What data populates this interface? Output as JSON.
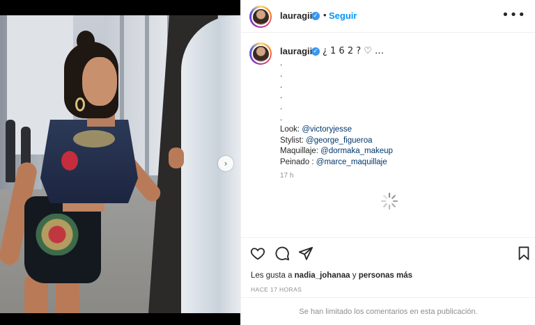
{
  "post": {
    "username": "lauragii",
    "follow_label": "Seguir",
    "header_dot": "•",
    "more_label": "•••",
    "caption_first": "¿ 1 6 2 ? ♡ …",
    "caption_lines": [
      {
        "text": ".",
        "mention": ""
      },
      {
        "text": ".",
        "mention": ""
      },
      {
        "text": ".",
        "mention": ""
      },
      {
        "text": ".",
        "mention": ""
      },
      {
        "text": ".",
        "mention": ""
      },
      {
        "text": ".",
        "mention": ""
      },
      {
        "text": "Look: ",
        "mention": "@victoryjesse"
      },
      {
        "text": "Stylist: ",
        "mention": "@george_figueroa"
      },
      {
        "text": "Maquillaje: ",
        "mention": "@dormaka_makeup"
      },
      {
        "text": "Peinado : ",
        "mention": "@marce_maquillaje"
      }
    ],
    "time": "17 h",
    "likes_prefix": "Les gusta a ",
    "likes_user": "nadia_johanaa",
    "likes_mid": " y ",
    "likes_suffix": "personas más",
    "ago": "HACE 17 HORAS",
    "comments_limited": "Se han limitado los comentarios en esta publicación."
  },
  "icons": {
    "verified": "verified-badge-icon",
    "heart": "heart-icon",
    "comment": "comment-icon",
    "share": "share-icon",
    "save": "bookmark-icon",
    "next": "chevron-right-icon",
    "loading": "loading-spinner-icon"
  },
  "colors": {
    "accent": "#0095f6",
    "verified": "#3897f0",
    "muted": "#8e8e8e"
  }
}
